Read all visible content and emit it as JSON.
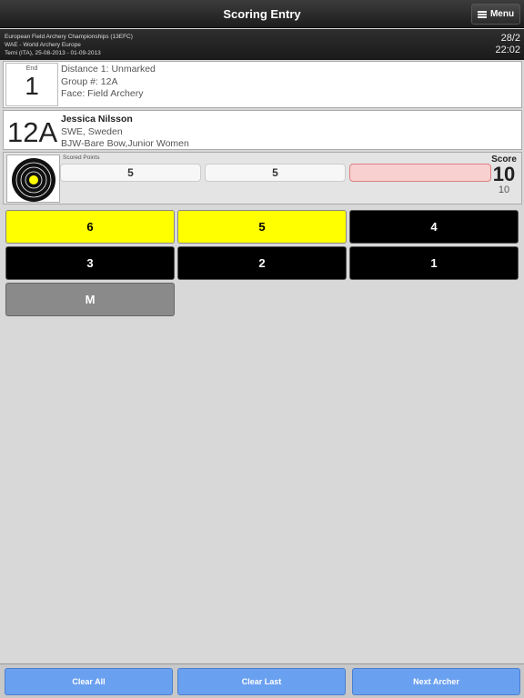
{
  "header": {
    "title": "Scoring Entry",
    "menu_label": "Menu"
  },
  "event": {
    "line1": "European Field Archery Championships (13EFC)",
    "line2": "WAE - World Archery Europe",
    "line3": "Terni (ITA), 25-08-2013 - 01-09-2013",
    "date": "28/2",
    "time": "22:02"
  },
  "end": {
    "label": "End",
    "number": "1",
    "distance": "Distance 1: Unmarked",
    "group": "Group #: 12A",
    "face": "Face: Field Archery"
  },
  "archer": {
    "target": "12A",
    "name": "Jessica Nilsson",
    "country": "SWE, Sweden",
    "category": "BJW-Bare Bow,Junior Women"
  },
  "scoring": {
    "scored_label": "Scored Points",
    "arrows": [
      "5",
      "5",
      ""
    ],
    "score_label": "Score",
    "score": "10",
    "total": "10"
  },
  "keypad": [
    {
      "label": "6",
      "color": "#ffff00"
    },
    {
      "label": "5",
      "color": "#ffff00"
    },
    {
      "label": "4",
      "color": "#000000"
    },
    {
      "label": "3",
      "color": "#000000"
    },
    {
      "label": "2",
      "color": "#000000"
    },
    {
      "label": "1",
      "color": "#000000"
    },
    {
      "label": "M",
      "color": "#8a8a8a"
    }
  ],
  "footer": {
    "clear_all": "Clear All",
    "clear_last": "Clear Last",
    "next_archer": "Next Archer"
  },
  "colors": {
    "accent": "#6aa0f0",
    "target_center": "#ffff00",
    "error_fill": "#f9d0d0"
  }
}
